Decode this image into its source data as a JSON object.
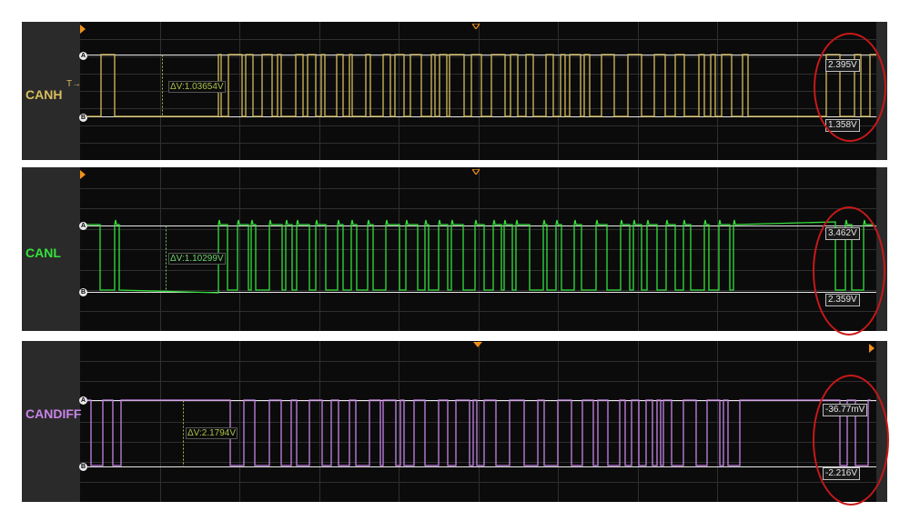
{
  "colors": {
    "canh": "#d7be5d",
    "canl": "#33e23a",
    "candiff": "#c784e6",
    "grid": "#2f2f2f",
    "cursor_line": "#e8e8e8",
    "annotation_ring": "#c81818",
    "marker": "#f0901a"
  },
  "channels": [
    {
      "id": "canh",
      "label": "CANH",
      "trigger_marker": "T→",
      "delta_readout": "ΔV:1.03654V",
      "cursor_a_value": "2.395V",
      "cursor_b_value": "1.358V",
      "cursor_a_tag": "A",
      "cursor_b_tag": "B"
    },
    {
      "id": "canl",
      "label": "CANL",
      "delta_readout": "ΔV:1.10299V",
      "cursor_a_value": "3.462V",
      "cursor_b_value": "2.359V",
      "cursor_a_tag": "A",
      "cursor_b_tag": "B"
    },
    {
      "id": "candiff",
      "label": "CANDIFF",
      "delta_readout": "ΔV:2.1794V",
      "cursor_a_value": "-36.77mV",
      "cursor_b_value": "-2.216V",
      "cursor_a_tag": "A",
      "cursor_b_tag": "B"
    }
  ]
}
